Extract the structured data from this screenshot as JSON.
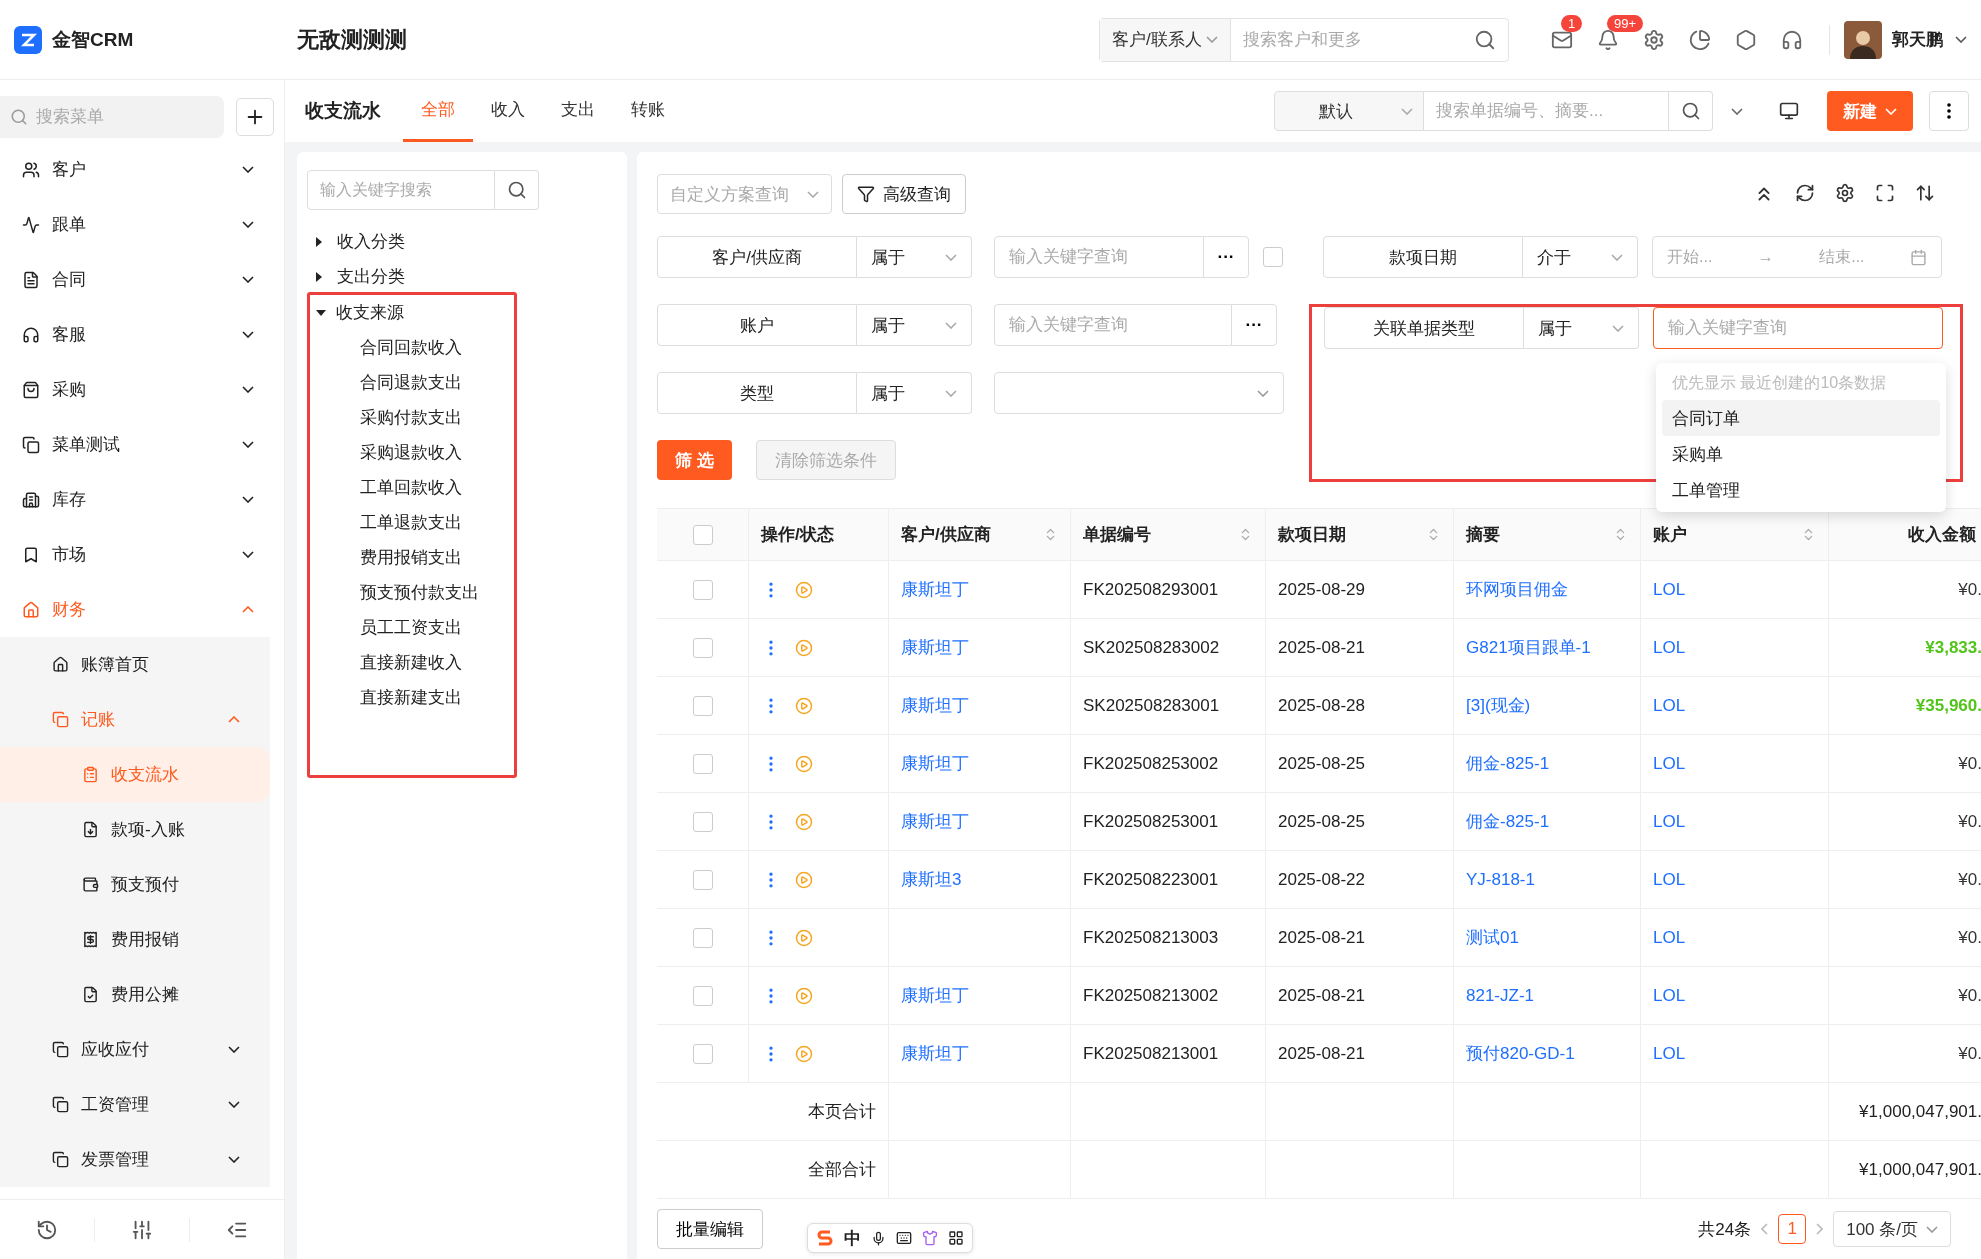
{
  "app": {
    "name": "金智CRM",
    "workspace": "无敌测测测"
  },
  "global_search": {
    "scope": "客户/联系人",
    "placeholder": "搜索客户和更多"
  },
  "notifications": [
    {
      "badge": "1"
    },
    {
      "badge": "99+"
    }
  ],
  "user": {
    "name": "郭天鹏"
  },
  "sidebar": {
    "search_placeholder": "搜索菜单",
    "items": [
      {
        "label": "客户",
        "expanded": false,
        "selected": false
      },
      {
        "label": "跟单",
        "expanded": false,
        "selected": false
      },
      {
        "label": "合同",
        "expanded": false,
        "selected": false
      },
      {
        "label": "客服",
        "expanded": false,
        "selected": false
      },
      {
        "label": "采购",
        "expanded": false,
        "selected": false
      },
      {
        "label": "菜单测试",
        "expanded": false,
        "selected": false
      },
      {
        "label": "库存",
        "expanded": false,
        "selected": false
      },
      {
        "label": "市场",
        "expanded": false,
        "selected": false
      },
      {
        "label": "财务",
        "expanded": true,
        "selected": true,
        "children": [
          {
            "label": "账簿首页",
            "selected": false
          },
          {
            "label": "记账",
            "expanded": true,
            "selected": true,
            "children": [
              {
                "label": "收支流水",
                "selected": true
              },
              {
                "label": "款项-入账",
                "selected": false
              },
              {
                "label": "预支预付",
                "selected": false
              },
              {
                "label": "费用报销",
                "selected": false
              },
              {
                "label": "费用公摊",
                "selected": false
              }
            ]
          },
          {
            "label": "应收应付",
            "expanded": false,
            "selected": false
          },
          {
            "label": "工资管理",
            "expanded": false,
            "selected": false
          },
          {
            "label": "发票管理",
            "expanded": false,
            "selected": false
          }
        ]
      }
    ]
  },
  "page": {
    "title": "收支流水",
    "tabs": [
      {
        "label": "全部",
        "selected": true
      },
      {
        "label": "收入",
        "selected": false
      },
      {
        "label": "支出",
        "selected": false
      },
      {
        "label": "转账",
        "selected": false
      }
    ],
    "view": "默认",
    "search_placeholder": "搜索单据编号、摘要...",
    "new_button": "新建"
  },
  "tree": {
    "search_placeholder": "输入关键字搜索",
    "nodes": [
      {
        "label": "收入分类",
        "expanded": false,
        "highlighted": false
      },
      {
        "label": "支出分类",
        "expanded": false,
        "highlighted": false
      },
      {
        "label": "收支来源",
        "expanded": true,
        "highlighted": true,
        "children": [
          "合同回款收入",
          "合同退款支出",
          "采购付款支出",
          "采购退款收入",
          "工单回款收入",
          "工单退款支出",
          "费用报销支出",
          "预支预付款支出",
          "员工工资支出",
          "直接新建收入",
          "直接新建支出"
        ]
      }
    ]
  },
  "query": {
    "scheme_placeholder": "自定义方案查询",
    "advanced": "高级查询"
  },
  "filters": {
    "left": [
      {
        "kind": "lookup",
        "field": "客户/供应商",
        "op": "属于",
        "placeholder": "输入关键字查询",
        "more": "···",
        "toggle": false
      },
      {
        "kind": "lookup",
        "field": "账户",
        "op": "属于",
        "placeholder": "输入关键字查询",
        "more": "···"
      },
      {
        "kind": "select",
        "field": "类型",
        "op": "属于"
      }
    ],
    "right": [
      {
        "kind": "daterange",
        "field": "款项日期",
        "op": "介于",
        "start": "开始...",
        "arrow": "→",
        "end": "结束..."
      },
      {
        "kind": "search",
        "field": "关联单据类型",
        "op": "属于",
        "placeholder": "输入关键字查询",
        "focused": true,
        "highlighted": true,
        "dropdown": {
          "hint": "优先显示 最近创建的10条数据",
          "options": [
            {
              "label": "合同订单",
              "selected": true
            },
            {
              "label": "采购单",
              "selected": false
            },
            {
              "label": "工单管理",
              "selected": false
            }
          ]
        }
      }
    ],
    "apply": "筛 选",
    "clear": "清除筛选条件"
  },
  "table": {
    "all_checked": false,
    "columns": [
      {
        "label": "操作/状态",
        "sortable": false
      },
      {
        "label": "客户/供应商",
        "sortable": true
      },
      {
        "label": "单据编号",
        "sortable": true
      },
      {
        "label": "款项日期",
        "sortable": true
      },
      {
        "label": "摘要",
        "sortable": true
      },
      {
        "label": "账户",
        "sortable": true
      },
      {
        "label": "收入金额",
        "sortable": false
      }
    ],
    "rows": [
      {
        "checked": false,
        "customer": "康斯坦丁",
        "number": "FK202508293001",
        "date": "2025-08-29",
        "summary": "环网项目佣金",
        "account": "LOL",
        "amount": "¥0.",
        "positive": false
      },
      {
        "checked": false,
        "customer": "康斯坦丁",
        "number": "SK202508283002",
        "date": "2025-08-21",
        "summary": "G821项目跟单-1",
        "account": "LOL",
        "amount": "¥3,833.",
        "positive": true
      },
      {
        "checked": false,
        "customer": "康斯坦丁",
        "number": "SK202508283001",
        "date": "2025-08-28",
        "summary": "[3](现金)",
        "account": "LOL",
        "amount": "¥35,960.",
        "positive": true
      },
      {
        "checked": false,
        "customer": "康斯坦丁",
        "number": "FK202508253002",
        "date": "2025-08-25",
        "summary": "佣金-825-1",
        "account": "LOL",
        "amount": "¥0.",
        "positive": false
      },
      {
        "checked": false,
        "customer": "康斯坦丁",
        "number": "FK202508253001",
        "date": "2025-08-25",
        "summary": "佣金-825-1",
        "account": "LOL",
        "amount": "¥0.",
        "positive": false
      },
      {
        "checked": false,
        "customer": "康斯坦3",
        "number": "FK202508223001",
        "date": "2025-08-22",
        "summary": "YJ-818-1",
        "account": "LOL",
        "amount": "¥0.",
        "positive": false
      },
      {
        "checked": false,
        "number": "FK202508213003",
        "date": "2025-08-21",
        "summary": "测试01",
        "account": "LOL",
        "amount": "¥0.",
        "positive": false
      },
      {
        "checked": false,
        "customer": "康斯坦丁",
        "number": "FK202508213002",
        "date": "2025-08-21",
        "summary": "821-JZ-1",
        "account": "LOL",
        "amount": "¥0.",
        "positive": false
      },
      {
        "checked": false,
        "customer": "康斯坦丁",
        "number": "FK202508213001",
        "date": "2025-08-21",
        "summary": "预付820-GD-1",
        "account": "LOL",
        "amount": "¥0.",
        "positive": false
      }
    ],
    "totals": [
      {
        "label": "本页合计",
        "amount": "¥1,000,047,901."
      },
      {
        "label": "全部合计",
        "amount": "¥1,000,047,901."
      }
    ]
  },
  "footer": {
    "batch_edit": "批量编辑",
    "count": "共24条",
    "pages": [
      {
        "label": "1",
        "selected": true
      }
    ],
    "page_size": "100 条/页"
  },
  "ime": {
    "mode": "中"
  }
}
